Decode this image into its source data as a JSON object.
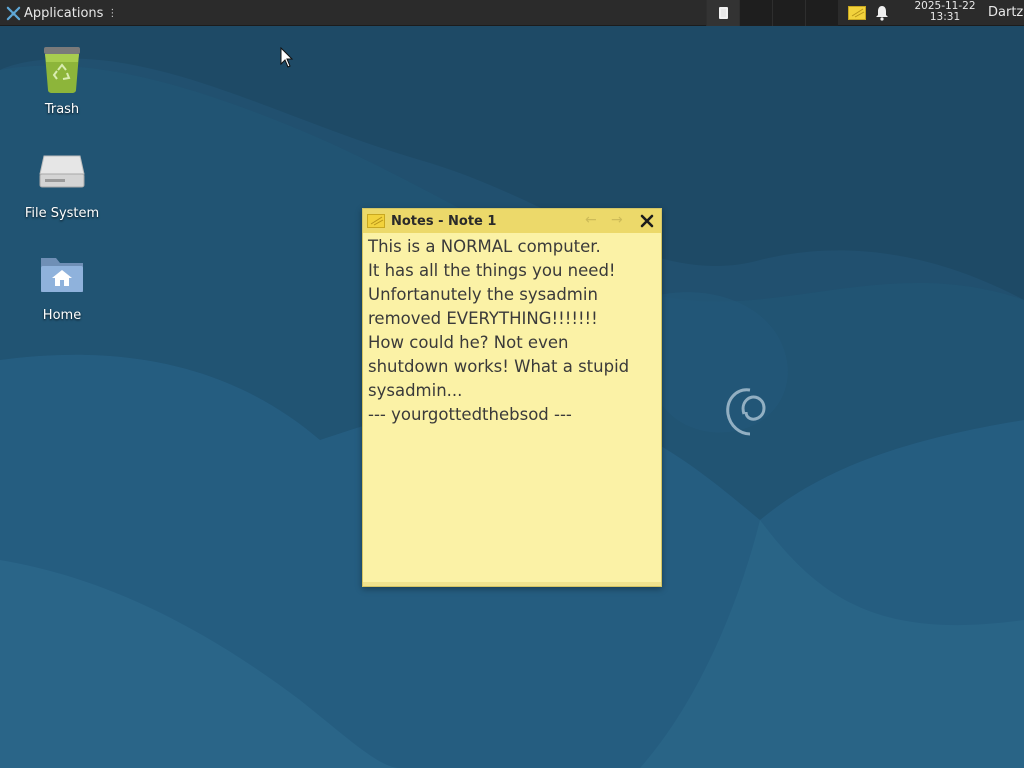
{
  "panel": {
    "applications_label": "Applications",
    "clock_date": "2025-11-22",
    "clock_time": "13:31",
    "user": "Dartz",
    "icons": [
      "applications-icon",
      "workspace-window-icon",
      "notes-tray-icon",
      "notification-bell-icon"
    ]
  },
  "desktop": {
    "icons": [
      {
        "label": "Trash",
        "icon": "trash-icon"
      },
      {
        "label": "File System",
        "icon": "drive-icon"
      },
      {
        "label": "Home",
        "icon": "home-folder-icon"
      }
    ]
  },
  "note": {
    "title": "Notes - Note 1",
    "body": "This is a NORMAL computer.\nIt has all the things you need!\nUnfortanutely the sysadmin\nremoved EVERYTHING!!!!!!!\nHow could he? Not even\nshutdown works! What a stupid\nsysadmin...\n--- yourgottedthebsod ---",
    "colors": {
      "background": "#fbf2a6",
      "titlebar": "#ecd96a"
    }
  },
  "colors": {
    "wallpaper_dark": "#1f4762",
    "wallpaper_light": "#2b6185",
    "panel": "#2b2b2b"
  }
}
